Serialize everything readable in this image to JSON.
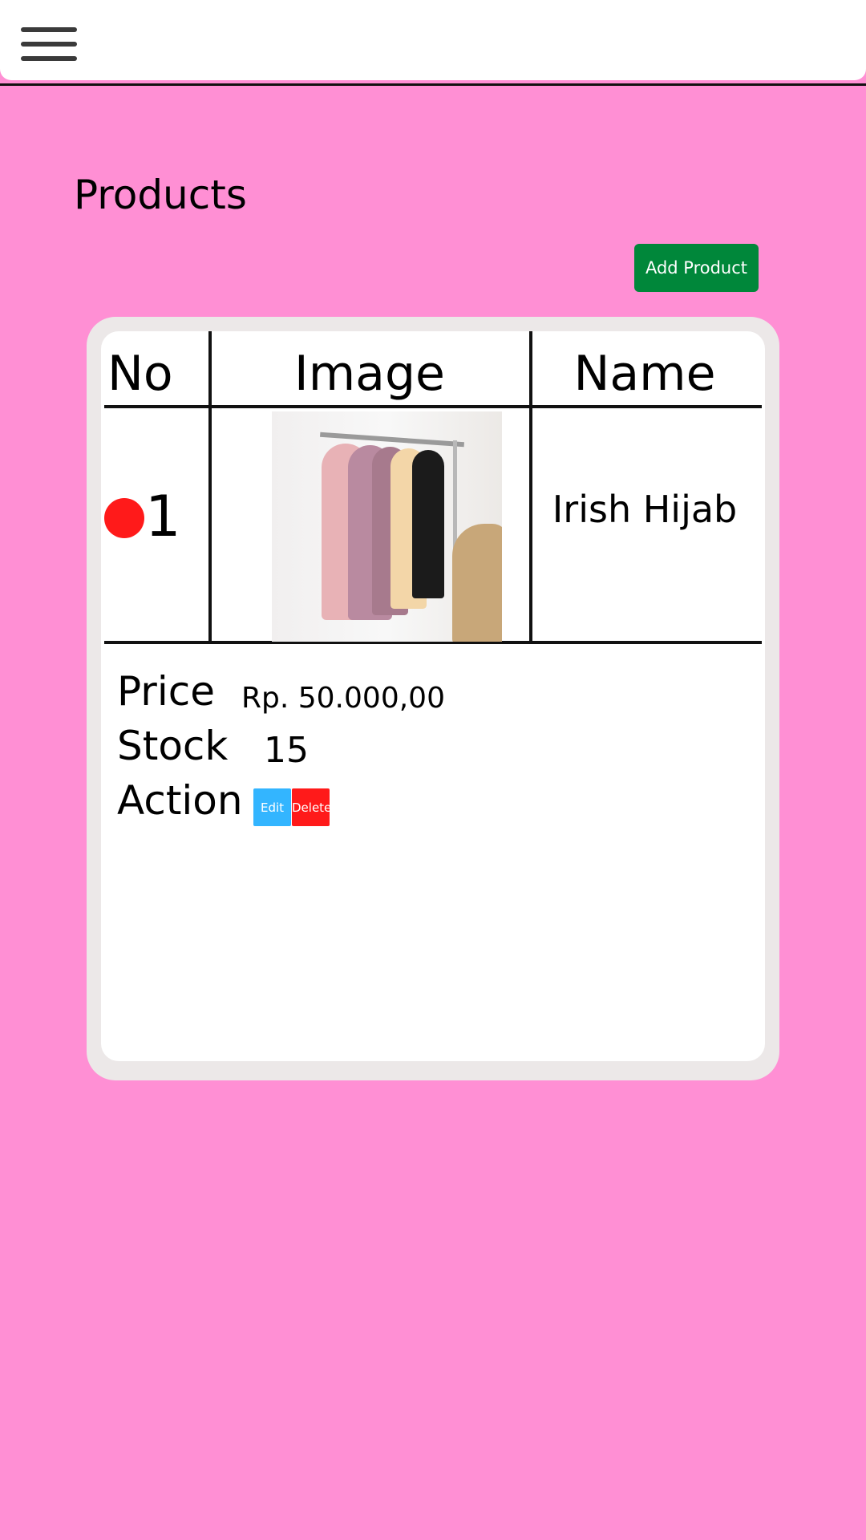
{
  "header": {
    "menu_icon": "hamburger-menu-icon"
  },
  "page": {
    "title": "Products",
    "add_button_label": "Add Product"
  },
  "table": {
    "columns": [
      "No",
      "Image",
      "Name"
    ],
    "rows": [
      {
        "no": "1",
        "status_color": "#ff1a1a",
        "name": "Irish Hijab",
        "price_label": "Price",
        "price": "Rp. 50.000,00",
        "stock_label": "Stock",
        "stock": "15",
        "action_label": "Action",
        "edit_label": "Edit",
        "delete_label": "Delete"
      }
    ]
  },
  "colors": {
    "background": "#ff8fd4",
    "add_button": "#00873a",
    "edit_button": "#33b5ff",
    "delete_button": "#ff1a1a"
  }
}
